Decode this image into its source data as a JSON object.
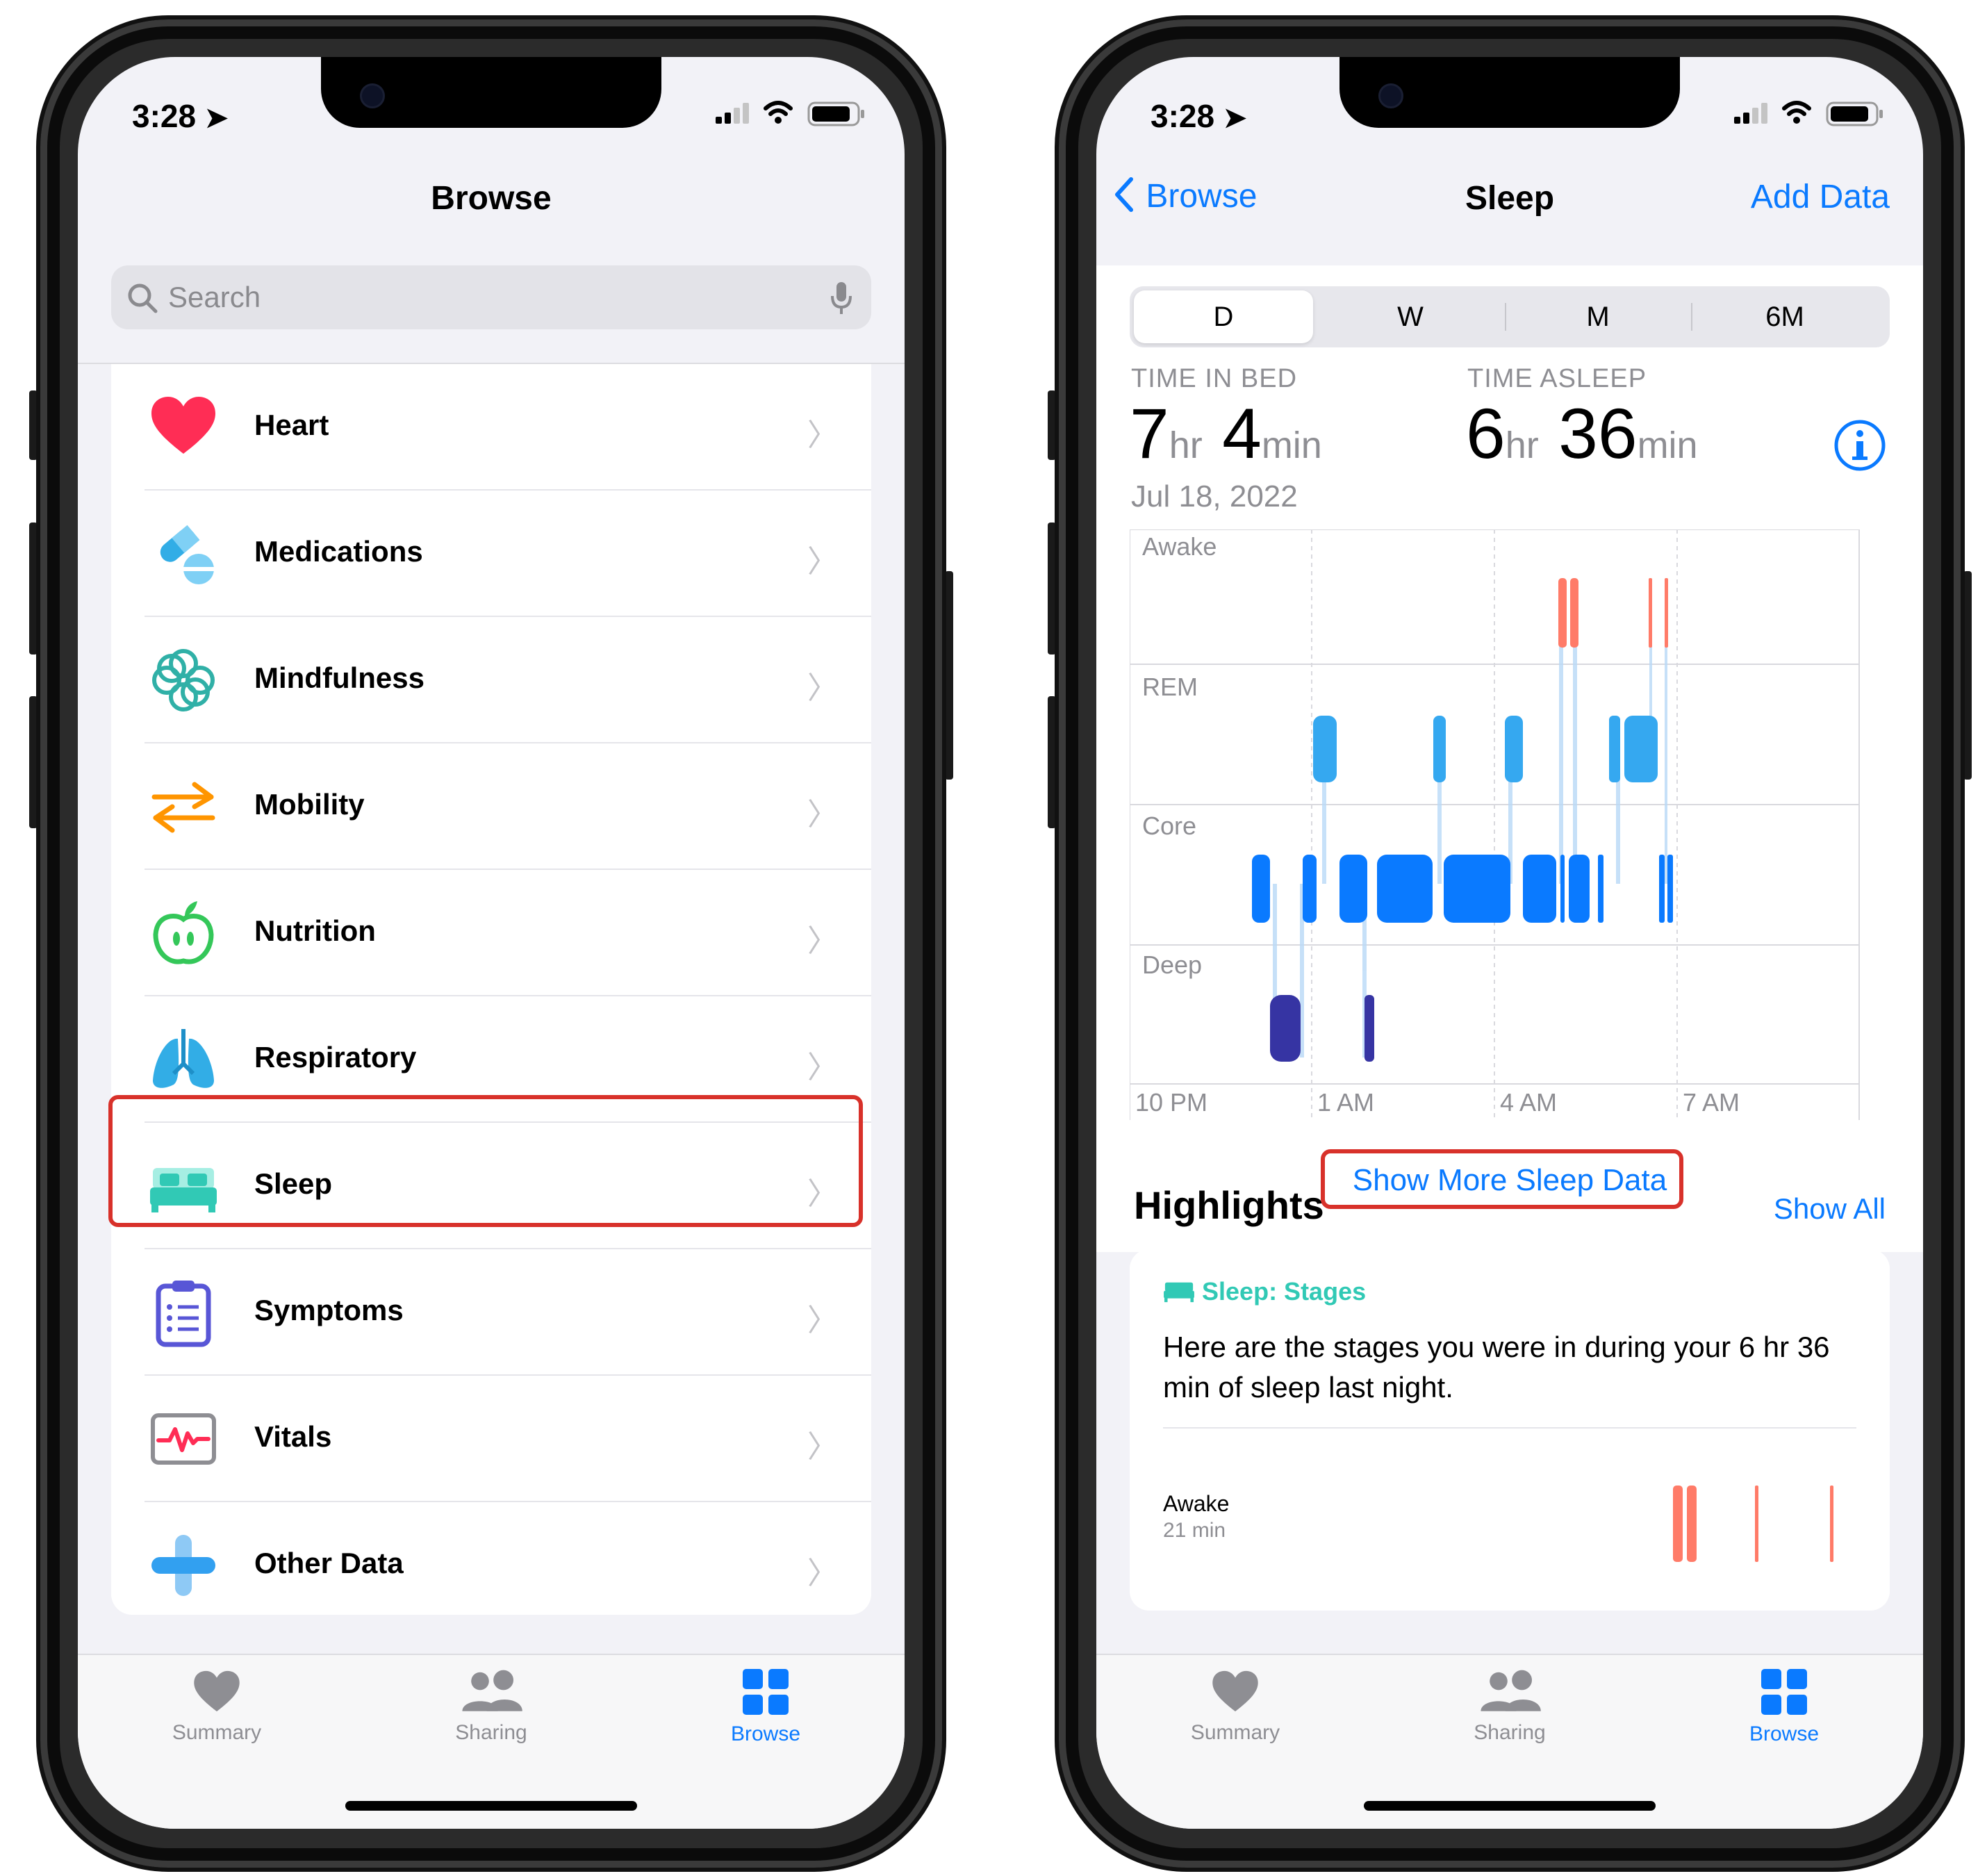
{
  "left_phone": {
    "status": {
      "time": "3:28"
    },
    "title": "Browse",
    "search": {
      "placeholder": "Search"
    },
    "categories": [
      {
        "label": "Heart",
        "icon": "heart-icon",
        "color": "#ff2d55"
      },
      {
        "label": "Medications",
        "icon": "pills-icon",
        "color": "#32ade6"
      },
      {
        "label": "Mindfulness",
        "icon": "flower-icon",
        "color": "#30b0a7"
      },
      {
        "label": "Mobility",
        "icon": "arrows-icon",
        "color": "#ff9500"
      },
      {
        "label": "Nutrition",
        "icon": "apple-icon",
        "color": "#34c759"
      },
      {
        "label": "Respiratory",
        "icon": "lungs-icon",
        "color": "#32ade6"
      },
      {
        "label": "Sleep",
        "icon": "bed-icon",
        "color": "#31c9b5"
      },
      {
        "label": "Symptoms",
        "icon": "clipboard-icon",
        "color": "#5856d6"
      },
      {
        "label": "Vitals",
        "icon": "waveform-icon",
        "color": "#ff2d55"
      },
      {
        "label": "Other Data",
        "icon": "plus-icon",
        "color": "#32ade6"
      }
    ],
    "highlighted": "Sleep",
    "tabs": [
      {
        "label": "Summary",
        "icon": "heart-tab-icon"
      },
      {
        "label": "Sharing",
        "icon": "people-icon"
      },
      {
        "label": "Browse",
        "icon": "grid-icon",
        "active": true
      }
    ]
  },
  "right_phone": {
    "status": {
      "time": "3:28"
    },
    "nav": {
      "back": "Browse",
      "title": "Sleep",
      "action": "Add Data"
    },
    "segments": [
      "D",
      "W",
      "M",
      "6M"
    ],
    "selected_segment": "D",
    "time_in_bed": {
      "label": "TIME IN BED",
      "hr": "7",
      "hr_unit": "hr",
      "min": "4",
      "min_unit": "min"
    },
    "time_asleep": {
      "label": "TIME ASLEEP",
      "hr": "6",
      "hr_unit": "hr",
      "min": "36",
      "min_unit": "min"
    },
    "date": "Jul 18, 2022",
    "chart": {
      "stages": [
        "Awake",
        "REM",
        "Core",
        "Deep"
      ],
      "x_labels": [
        "10 PM",
        "1 AM",
        "4 AM",
        "7 AM"
      ],
      "colors": {
        "awake": "#ff7b68",
        "rem": "#35a8f0",
        "core": "#0a7aff",
        "deep": "#3634a3"
      }
    },
    "show_more": "Show More Sleep Data",
    "highlights": {
      "title": "Highlights",
      "show_all": "Show All",
      "card_tag": "Sleep: Stages",
      "card_text": "Here are the stages you were in during your 6 hr 36 min of sleep last night.",
      "stage_label": "Awake",
      "stage_value": "21 min"
    },
    "tabs": [
      {
        "label": "Summary",
        "icon": "heart-tab-icon"
      },
      {
        "label": "Sharing",
        "icon": "people-icon"
      },
      {
        "label": "Browse",
        "icon": "grid-icon",
        "active": true
      }
    ]
  }
}
